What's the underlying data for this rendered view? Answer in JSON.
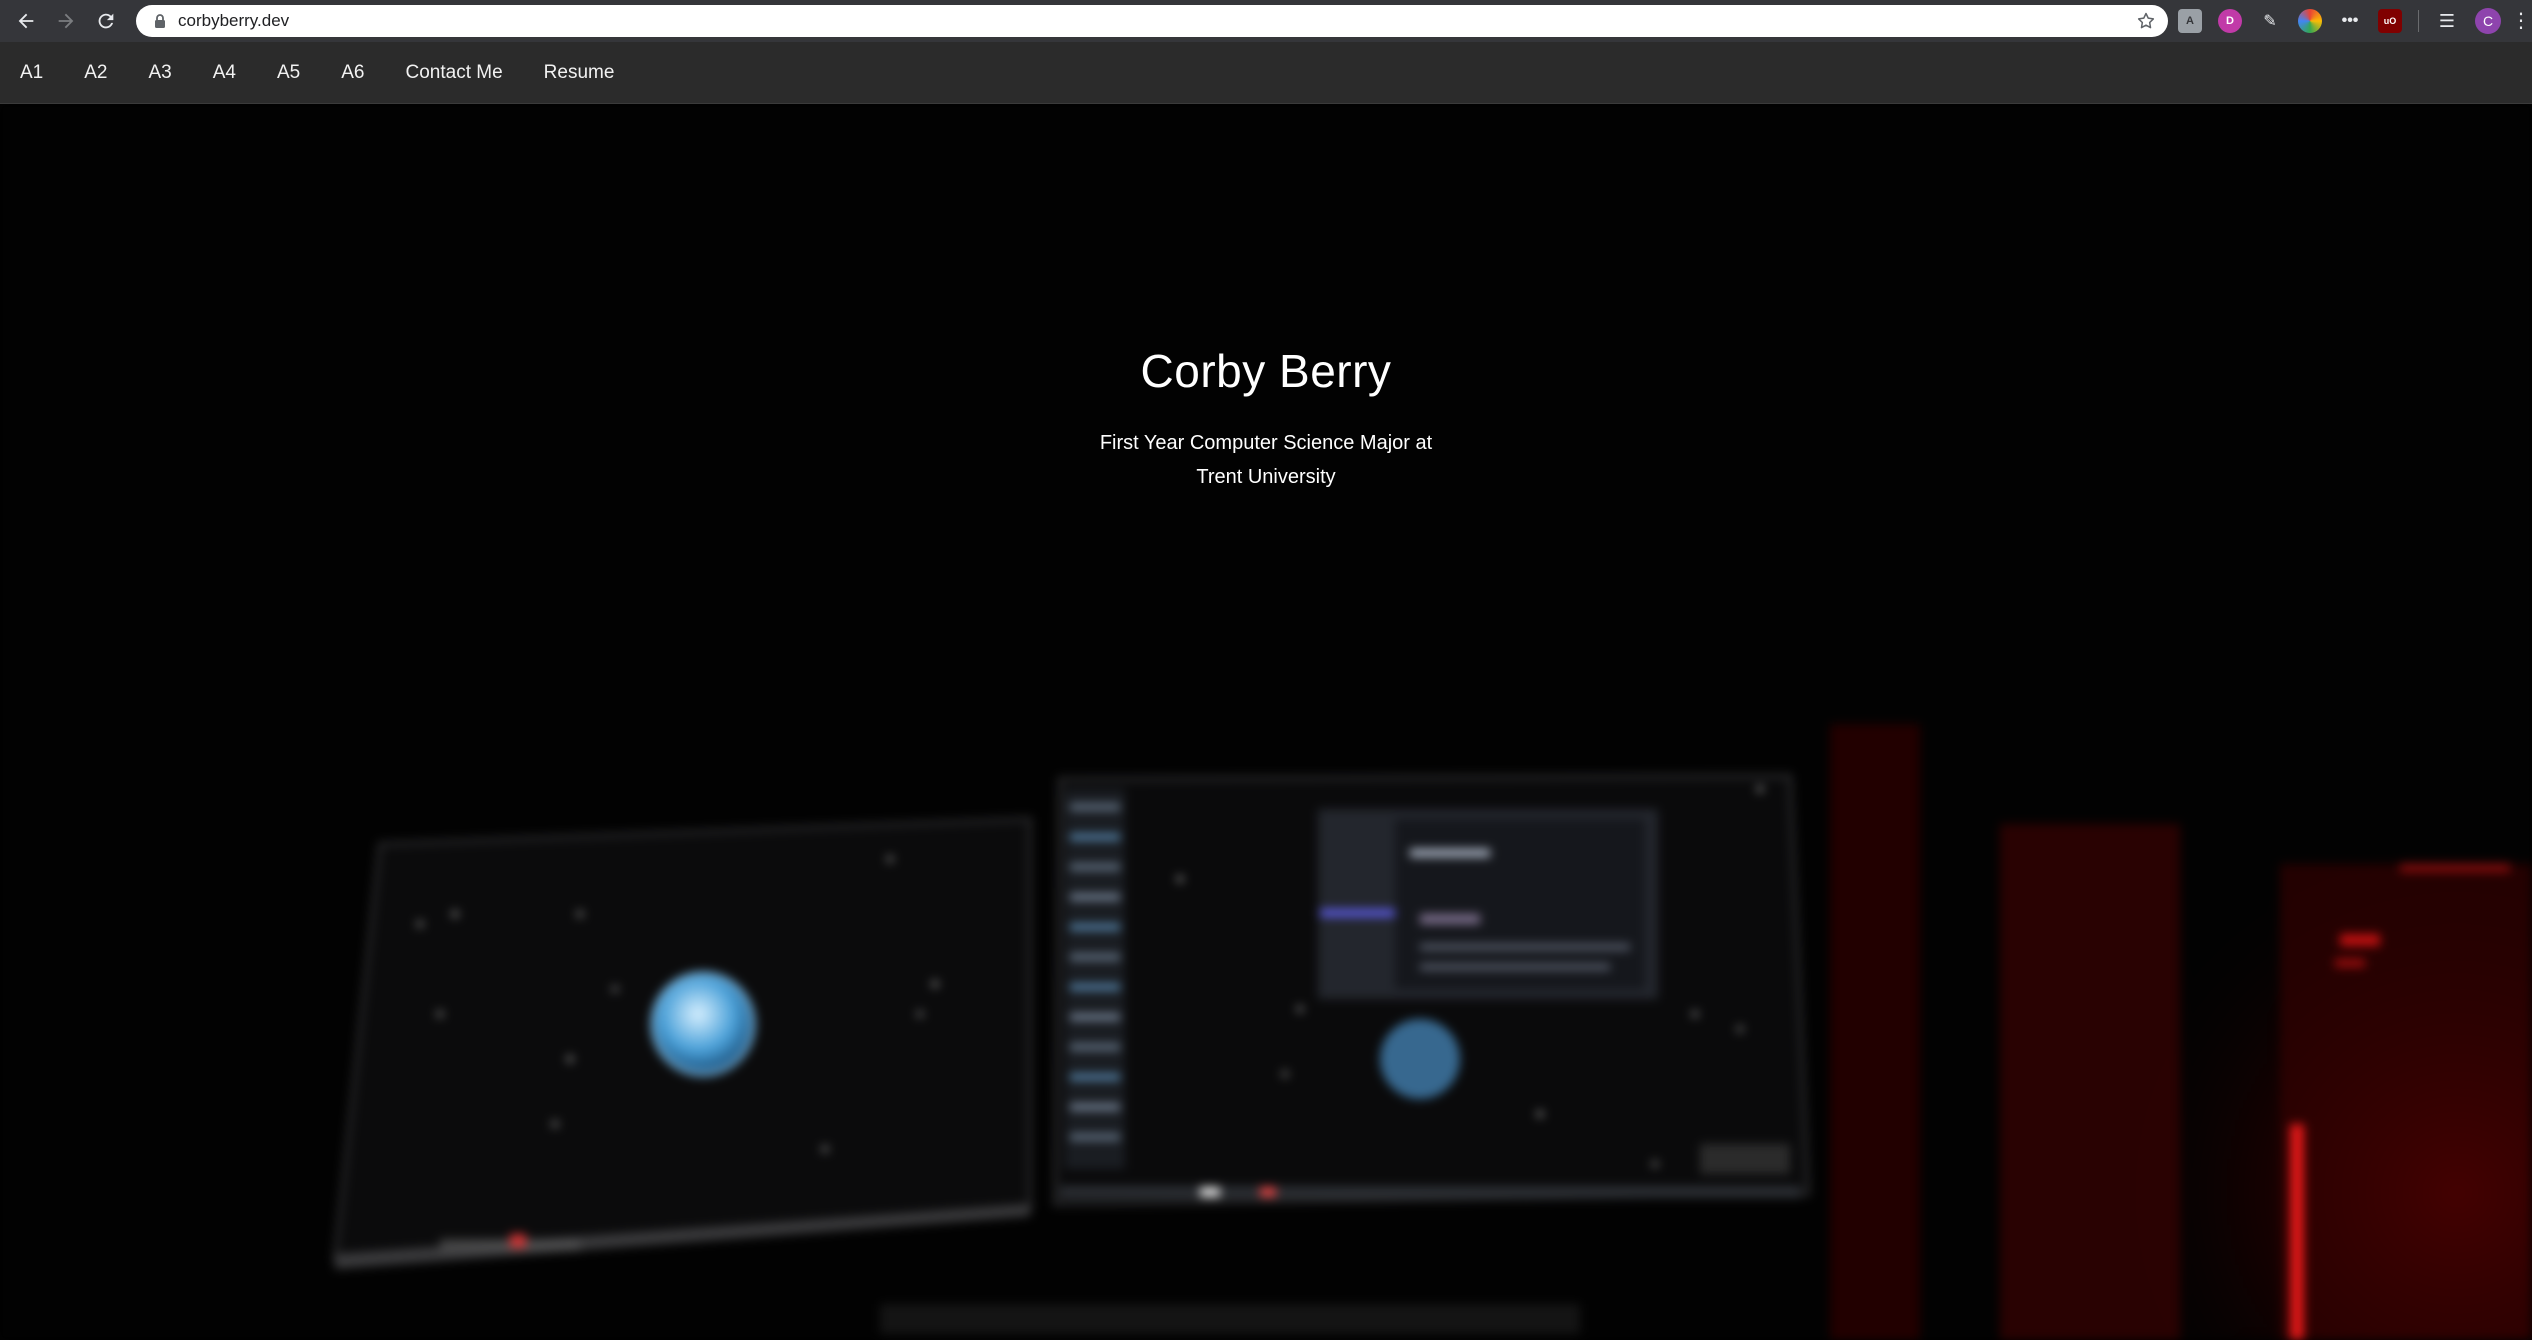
{
  "browser": {
    "url": "corbyberry.dev",
    "extensions": [
      {
        "icon": "generic-extension-icon",
        "label": "",
        "color": "#9aa0a6"
      },
      {
        "icon": "d-extension-icon",
        "label": "D",
        "color": "#c13aa8"
      },
      {
        "icon": "pen-extension-icon",
        "label": "",
        "color": "#5f6368"
      },
      {
        "icon": "colorful-extension-icon",
        "label": "",
        "color": "#4285f4"
      },
      {
        "icon": "dots-extension-icon",
        "label": "",
        "color": "#3c4043"
      },
      {
        "icon": "ublock-origin-icon",
        "label": "uO",
        "color": "#800000"
      }
    ],
    "profile_initial": "C"
  },
  "nav": {
    "items": [
      "A1",
      "A2",
      "A3",
      "A4",
      "A5",
      "A6",
      "Contact Me",
      "Resume"
    ]
  },
  "hero": {
    "title": "Corby Berry",
    "subtitle_line1": "First Year Computer Science Major at",
    "subtitle_line2": "Trent University"
  },
  "colors": {
    "chrome": "#35363a",
    "navbar": "#2b2b2b",
    "hero_bg": "#020202",
    "accent_red": "#d41414"
  }
}
